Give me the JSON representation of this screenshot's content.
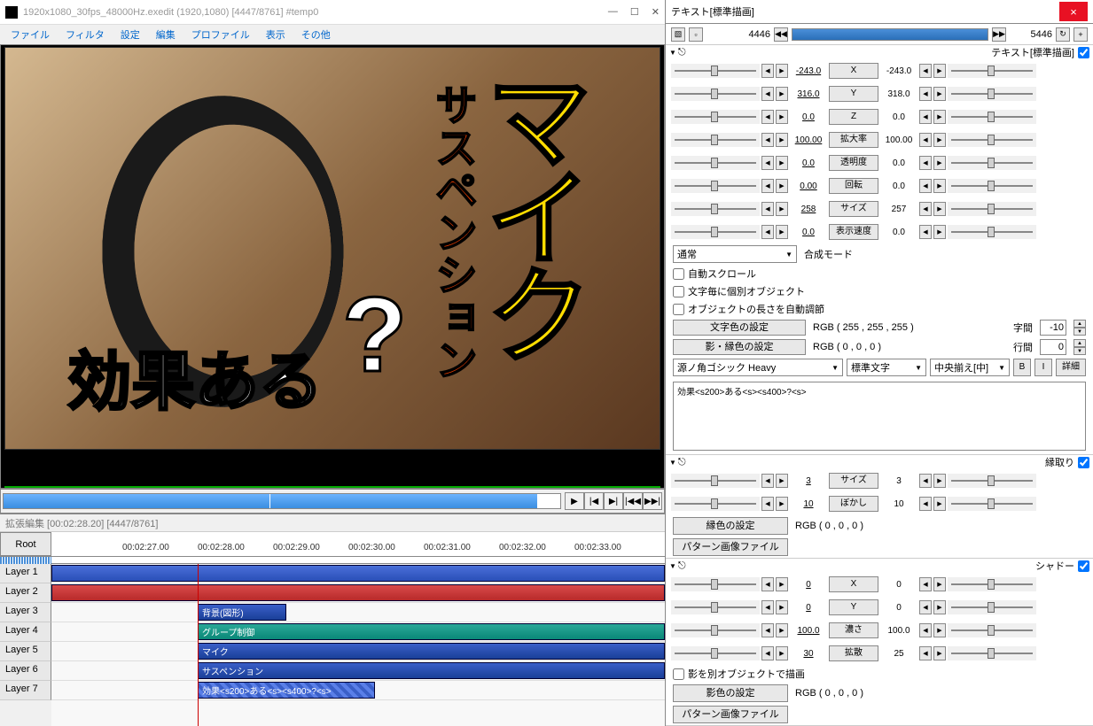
{
  "main": {
    "title": "1920x1080_30fps_48000Hz.exedit (1920,1080) [4447/8761] #temp0",
    "menu": [
      "ファイル",
      "フィルタ",
      "設定",
      "編集",
      "プロファイル",
      "表示",
      "その他"
    ],
    "preview": {
      "text_mic": "マイク",
      "text_susp": "サスペンション",
      "text_effect": "効果ある",
      "text_q": "?"
    }
  },
  "scrub_btns": [
    "▶",
    "|◀",
    "▶|",
    "|◀◀",
    "▶▶|"
  ],
  "timeline": {
    "title": "拡張編集 [00:02:28.20] [4447/8761]",
    "root": "Root",
    "ticks": [
      "00:02:27.00",
      "00:02:28.00",
      "00:02:29.00",
      "00:02:30.00",
      "00:02:31.00",
      "00:02:32.00",
      "00:02:33.00"
    ],
    "layers": [
      "Layer 1",
      "Layer 2",
      "Layer 3",
      "Layer 4",
      "Layer 5",
      "Layer 6",
      "Layer 7"
    ],
    "clips": {
      "l3": "背景(図形)",
      "l4": "グループ制御",
      "l5": "マイク",
      "l6": "サスペンション",
      "l7": "効果<s200>ある<s><s400>?<s>"
    }
  },
  "rp": {
    "title": "テキスト[標準描画]",
    "frame_start": "4446",
    "frame_end": "5446",
    "section1_label": "テキスト[標準描画]",
    "params": [
      {
        "val1": "-243.0",
        "label": "X",
        "val2": "-243.0"
      },
      {
        "val1": "316.0",
        "label": "Y",
        "val2": "318.0"
      },
      {
        "val1": "0.0",
        "label": "Z",
        "val2": "0.0"
      },
      {
        "val1": "100.00",
        "label": "拡大率",
        "val2": "100.00"
      },
      {
        "val1": "0.0",
        "label": "透明度",
        "val2": "0.0"
      },
      {
        "val1": "0.00",
        "label": "回転",
        "val2": "0.0"
      },
      {
        "val1": "258",
        "label": "サイズ",
        "val2": "257"
      },
      {
        "val1": "0.0",
        "label": "表示速度",
        "val2": "0.0"
      }
    ],
    "blend_label": "合成モード",
    "blend_value": "通常",
    "checks": [
      "自動スクロール",
      "文字毎に個別オブジェクト",
      "オブジェクトの長さを自動調節"
    ],
    "text_color_btn": "文字色の設定",
    "text_color_val": "RGB ( 255 , 255 , 255 )",
    "shadow_color_btn": "影・縁色の設定",
    "shadow_color_val": "RGB ( 0 , 0 , 0 )",
    "spacing_label": "字間",
    "spacing_val": "-10",
    "line_label": "行間",
    "line_val": "0",
    "font": "源ノ角ゴシック Heavy",
    "font_type": "標準文字",
    "align": "中央揃え[中]",
    "btn_b": "B",
    "btn_i": "I",
    "btn_detail": "詳細",
    "text_content": "効果<s200>ある<s><s400>?<s>",
    "outline": {
      "label": "縁取り",
      "params": [
        {
          "val1": "3",
          "label": "サイズ",
          "val2": "3"
        },
        {
          "val1": "10",
          "label": "ぼかし",
          "val2": "10"
        }
      ],
      "color_btn": "縁色の設定",
      "color_val": "RGB ( 0 , 0 , 0 )",
      "pattern_btn": "パターン画像ファイル"
    },
    "shadow": {
      "label": "シャドー",
      "params": [
        {
          "val1": "0",
          "label": "X",
          "val2": "0"
        },
        {
          "val1": "0",
          "label": "Y",
          "val2": "0"
        },
        {
          "val1": "100.0",
          "label": "濃さ",
          "val2": "100.0"
        },
        {
          "val1": "30",
          "label": "拡散",
          "val2": "25"
        }
      ],
      "sep_check": "影を別オブジェクトで描画",
      "color_btn": "影色の設定",
      "color_val": "RGB ( 0 , 0 , 0 )",
      "pattern_btn": "パターン画像ファイル"
    }
  }
}
